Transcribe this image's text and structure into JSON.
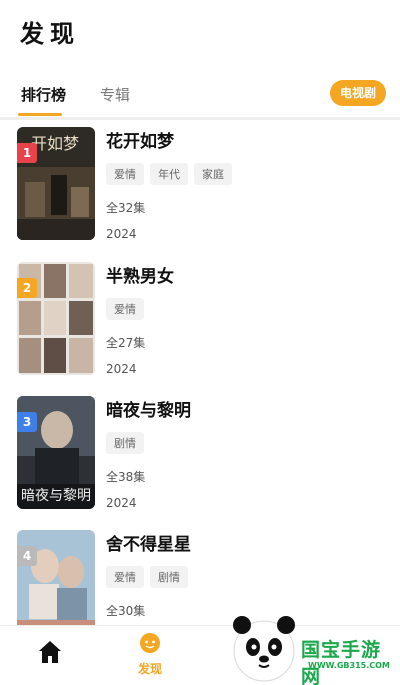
{
  "header": {
    "title": "发现"
  },
  "tabs": [
    {
      "label": "排行榜",
      "active": true
    },
    {
      "label": "专辑",
      "active": false
    }
  ],
  "filter_pill": {
    "label": "电视剧"
  },
  "accent_color": "#f5a623",
  "items": [
    {
      "rank": "1",
      "title": "花开如梦",
      "tags": [
        "爱情",
        "年代",
        "家庭"
      ],
      "episodes": "全32集",
      "year": "2024",
      "badge_color": "#e8434b",
      "poster_text": "开如梦"
    },
    {
      "rank": "2",
      "title": "半熟男女",
      "tags": [
        "爱情"
      ],
      "episodes": "全27集",
      "year": "2024",
      "badge_color": "#f5a623",
      "poster_text": ""
    },
    {
      "rank": "3",
      "title": "暗夜与黎明",
      "tags": [
        "剧情"
      ],
      "episodes": "全38集",
      "year": "2024",
      "badge_color": "#3f7fe8",
      "poster_text": "暗夜与黎明"
    },
    {
      "rank": "4",
      "title": "舍不得星星",
      "tags": [
        "爱情",
        "剧情"
      ],
      "episodes": "全30集",
      "year": "",
      "badge_color": "#b9b9b9",
      "poster_text": ""
    }
  ],
  "tabbar": {
    "discover_label": "发现",
    "home_icon": "home-icon",
    "discover_icon": "discover-icon"
  },
  "watermark": {
    "brand": "国宝手游网",
    "url": "WWW.GB315.COM"
  }
}
